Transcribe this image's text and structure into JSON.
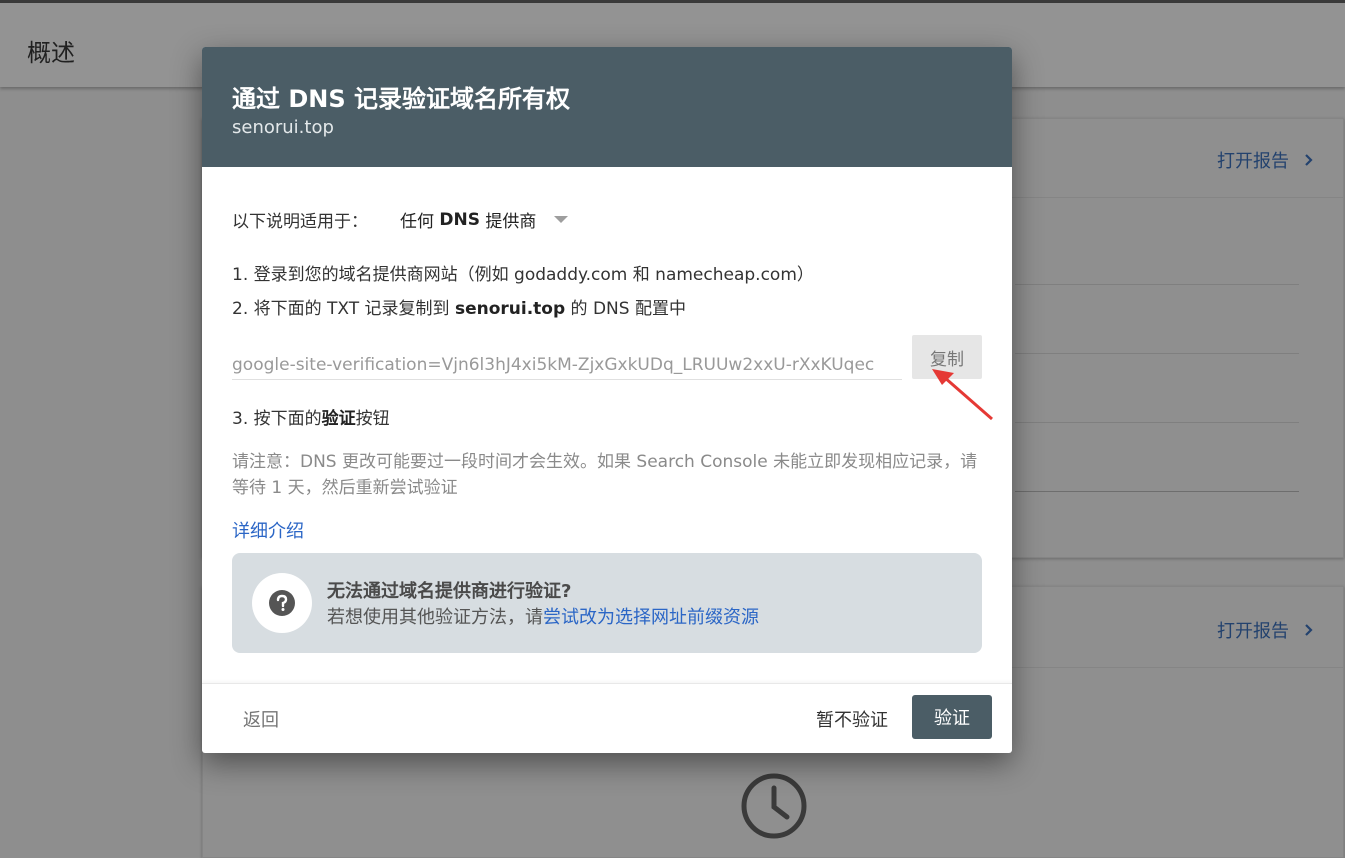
{
  "page": {
    "title": "概述",
    "open_report_label": "打开报告"
  },
  "dialog": {
    "title": "通过 DNS 记录验证域名所有权",
    "domain": "senorui.top",
    "applies_label": "以下说明适用于：",
    "provider": {
      "prefix": "任何 ",
      "bold": "DNS",
      "suffix": " 提供商"
    },
    "step1": "1. 登录到您的域名提供商网站（例如 godaddy.com 和 namecheap.com）",
    "step2": {
      "prefix": "2. 将下面的 TXT 记录复制到 ",
      "bold": "senorui.top",
      "suffix": " 的 DNS 配置中"
    },
    "txt_record": "google-site-verification=Vjn6l3hJ4xi5kM-ZjxGxkUDq_LRUUw2xxU-rXxKUqec",
    "copy_label": "复制",
    "step3": {
      "prefix": "3. 按下面的",
      "bold": "验证",
      "suffix": "按钮"
    },
    "note": "请注意：DNS 更改可能要过一段时间才会生效。如果 Search Console 未能立即发现相应记录，请等待 1 天，然后重新尝试验证",
    "learn_more": "详细介绍",
    "alt": {
      "title": "无法通过域名提供商进行验证?",
      "text_prefix": "若想使用其他验证方法，请",
      "link": "尝试改为选择网址前缀资源"
    },
    "footer": {
      "back": "返回",
      "skip": "暂不验证",
      "verify": "验证"
    }
  },
  "colors": {
    "header": "#4b5d66",
    "link": "#2b66c6",
    "annotation_arrow": "#e53935"
  }
}
